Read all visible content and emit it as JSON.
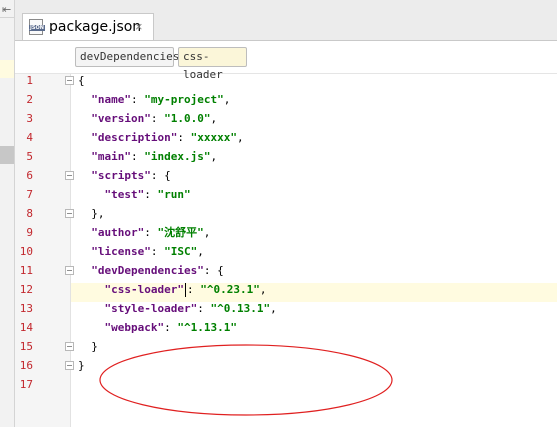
{
  "tab": {
    "title": "package.json",
    "icon_text": "JSON",
    "close_glyph": "×"
  },
  "left_strip": {
    "arrow_glyph": "⇤"
  },
  "breadcrumbs": [
    "devDependencies",
    "css-loader"
  ],
  "lines": [
    {
      "num": "1",
      "tokens": [
        {
          "t": "{",
          "c": "p"
        }
      ]
    },
    {
      "num": "2",
      "tokens": [
        {
          "t": "  ",
          "c": "p"
        },
        {
          "t": "\"name\"",
          "c": "k"
        },
        {
          "t": ": ",
          "c": "p"
        },
        {
          "t": "\"my-project\"",
          "c": "s"
        },
        {
          "t": ",",
          "c": "p"
        }
      ]
    },
    {
      "num": "3",
      "tokens": [
        {
          "t": "  ",
          "c": "p"
        },
        {
          "t": "\"version\"",
          "c": "k"
        },
        {
          "t": ": ",
          "c": "p"
        },
        {
          "t": "\"1.0.0\"",
          "c": "s"
        },
        {
          "t": ",",
          "c": "p"
        }
      ]
    },
    {
      "num": "4",
      "tokens": [
        {
          "t": "  ",
          "c": "p"
        },
        {
          "t": "\"description\"",
          "c": "k"
        },
        {
          "t": ": ",
          "c": "p"
        },
        {
          "t": "\"xxxxx\"",
          "c": "s"
        },
        {
          "t": ",",
          "c": "p"
        }
      ]
    },
    {
      "num": "5",
      "tokens": [
        {
          "t": "  ",
          "c": "p"
        },
        {
          "t": "\"main\"",
          "c": "k"
        },
        {
          "t": ": ",
          "c": "p"
        },
        {
          "t": "\"index.js\"",
          "c": "s"
        },
        {
          "t": ",",
          "c": "p"
        }
      ]
    },
    {
      "num": "6",
      "tokens": [
        {
          "t": "  ",
          "c": "p"
        },
        {
          "t": "\"scripts\"",
          "c": "k"
        },
        {
          "t": ": {",
          "c": "p"
        }
      ]
    },
    {
      "num": "7",
      "tokens": [
        {
          "t": "    ",
          "c": "p"
        },
        {
          "t": "\"test\"",
          "c": "k"
        },
        {
          "t": ": ",
          "c": "p"
        },
        {
          "t": "\"run\"",
          "c": "s"
        }
      ]
    },
    {
      "num": "8",
      "tokens": [
        {
          "t": "  },",
          "c": "p"
        }
      ]
    },
    {
      "num": "9",
      "tokens": [
        {
          "t": "  ",
          "c": "p"
        },
        {
          "t": "\"author\"",
          "c": "k"
        },
        {
          "t": ": ",
          "c": "p"
        },
        {
          "t": "\"沈舒平\"",
          "c": "s"
        },
        {
          "t": ",",
          "c": "p"
        }
      ]
    },
    {
      "num": "10",
      "tokens": [
        {
          "t": "  ",
          "c": "p"
        },
        {
          "t": "\"license\"",
          "c": "k"
        },
        {
          "t": ": ",
          "c": "p"
        },
        {
          "t": "\"ISC\"",
          "c": "s"
        },
        {
          "t": ",",
          "c": "p"
        }
      ]
    },
    {
      "num": "11",
      "tokens": [
        {
          "t": "  ",
          "c": "p"
        },
        {
          "t": "\"devDependencies\"",
          "c": "k"
        },
        {
          "t": ": {",
          "c": "p"
        }
      ]
    },
    {
      "num": "12",
      "tokens": [
        {
          "t": "    ",
          "c": "p"
        },
        {
          "t": "\"css-loader\"",
          "c": "k"
        },
        {
          "t": "|",
          "c": "caret"
        },
        {
          "t": ": ",
          "c": "p"
        },
        {
          "t": "\"^0.23.1\"",
          "c": "s"
        },
        {
          "t": ",",
          "c": "p"
        }
      ]
    },
    {
      "num": "13",
      "tokens": [
        {
          "t": "    ",
          "c": "p"
        },
        {
          "t": "\"style-loader\"",
          "c": "k"
        },
        {
          "t": ": ",
          "c": "p"
        },
        {
          "t": "\"^0.13.1\"",
          "c": "s"
        },
        {
          "t": ",",
          "c": "p"
        }
      ]
    },
    {
      "num": "14",
      "tokens": [
        {
          "t": "    ",
          "c": "p"
        },
        {
          "t": "\"webpack\"",
          "c": "k"
        },
        {
          "t": ": ",
          "c": "p"
        },
        {
          "t": "\"^1.13.1\"",
          "c": "s"
        }
      ]
    },
    {
      "num": "15",
      "tokens": [
        {
          "t": "  }",
          "c": "p"
        }
      ]
    },
    {
      "num": "16",
      "tokens": [
        {
          "t": "}",
          "c": "p"
        }
      ]
    },
    {
      "num": "17",
      "tokens": []
    }
  ],
  "folds_at_lines": [
    "1",
    "6",
    "8",
    "11",
    "15",
    "16"
  ],
  "colors": {
    "key": "#660e7a",
    "string": "#008000",
    "line_number": "#c2272d",
    "current_line": "#fffbe0",
    "annotation_ellipse": "#e02020"
  }
}
